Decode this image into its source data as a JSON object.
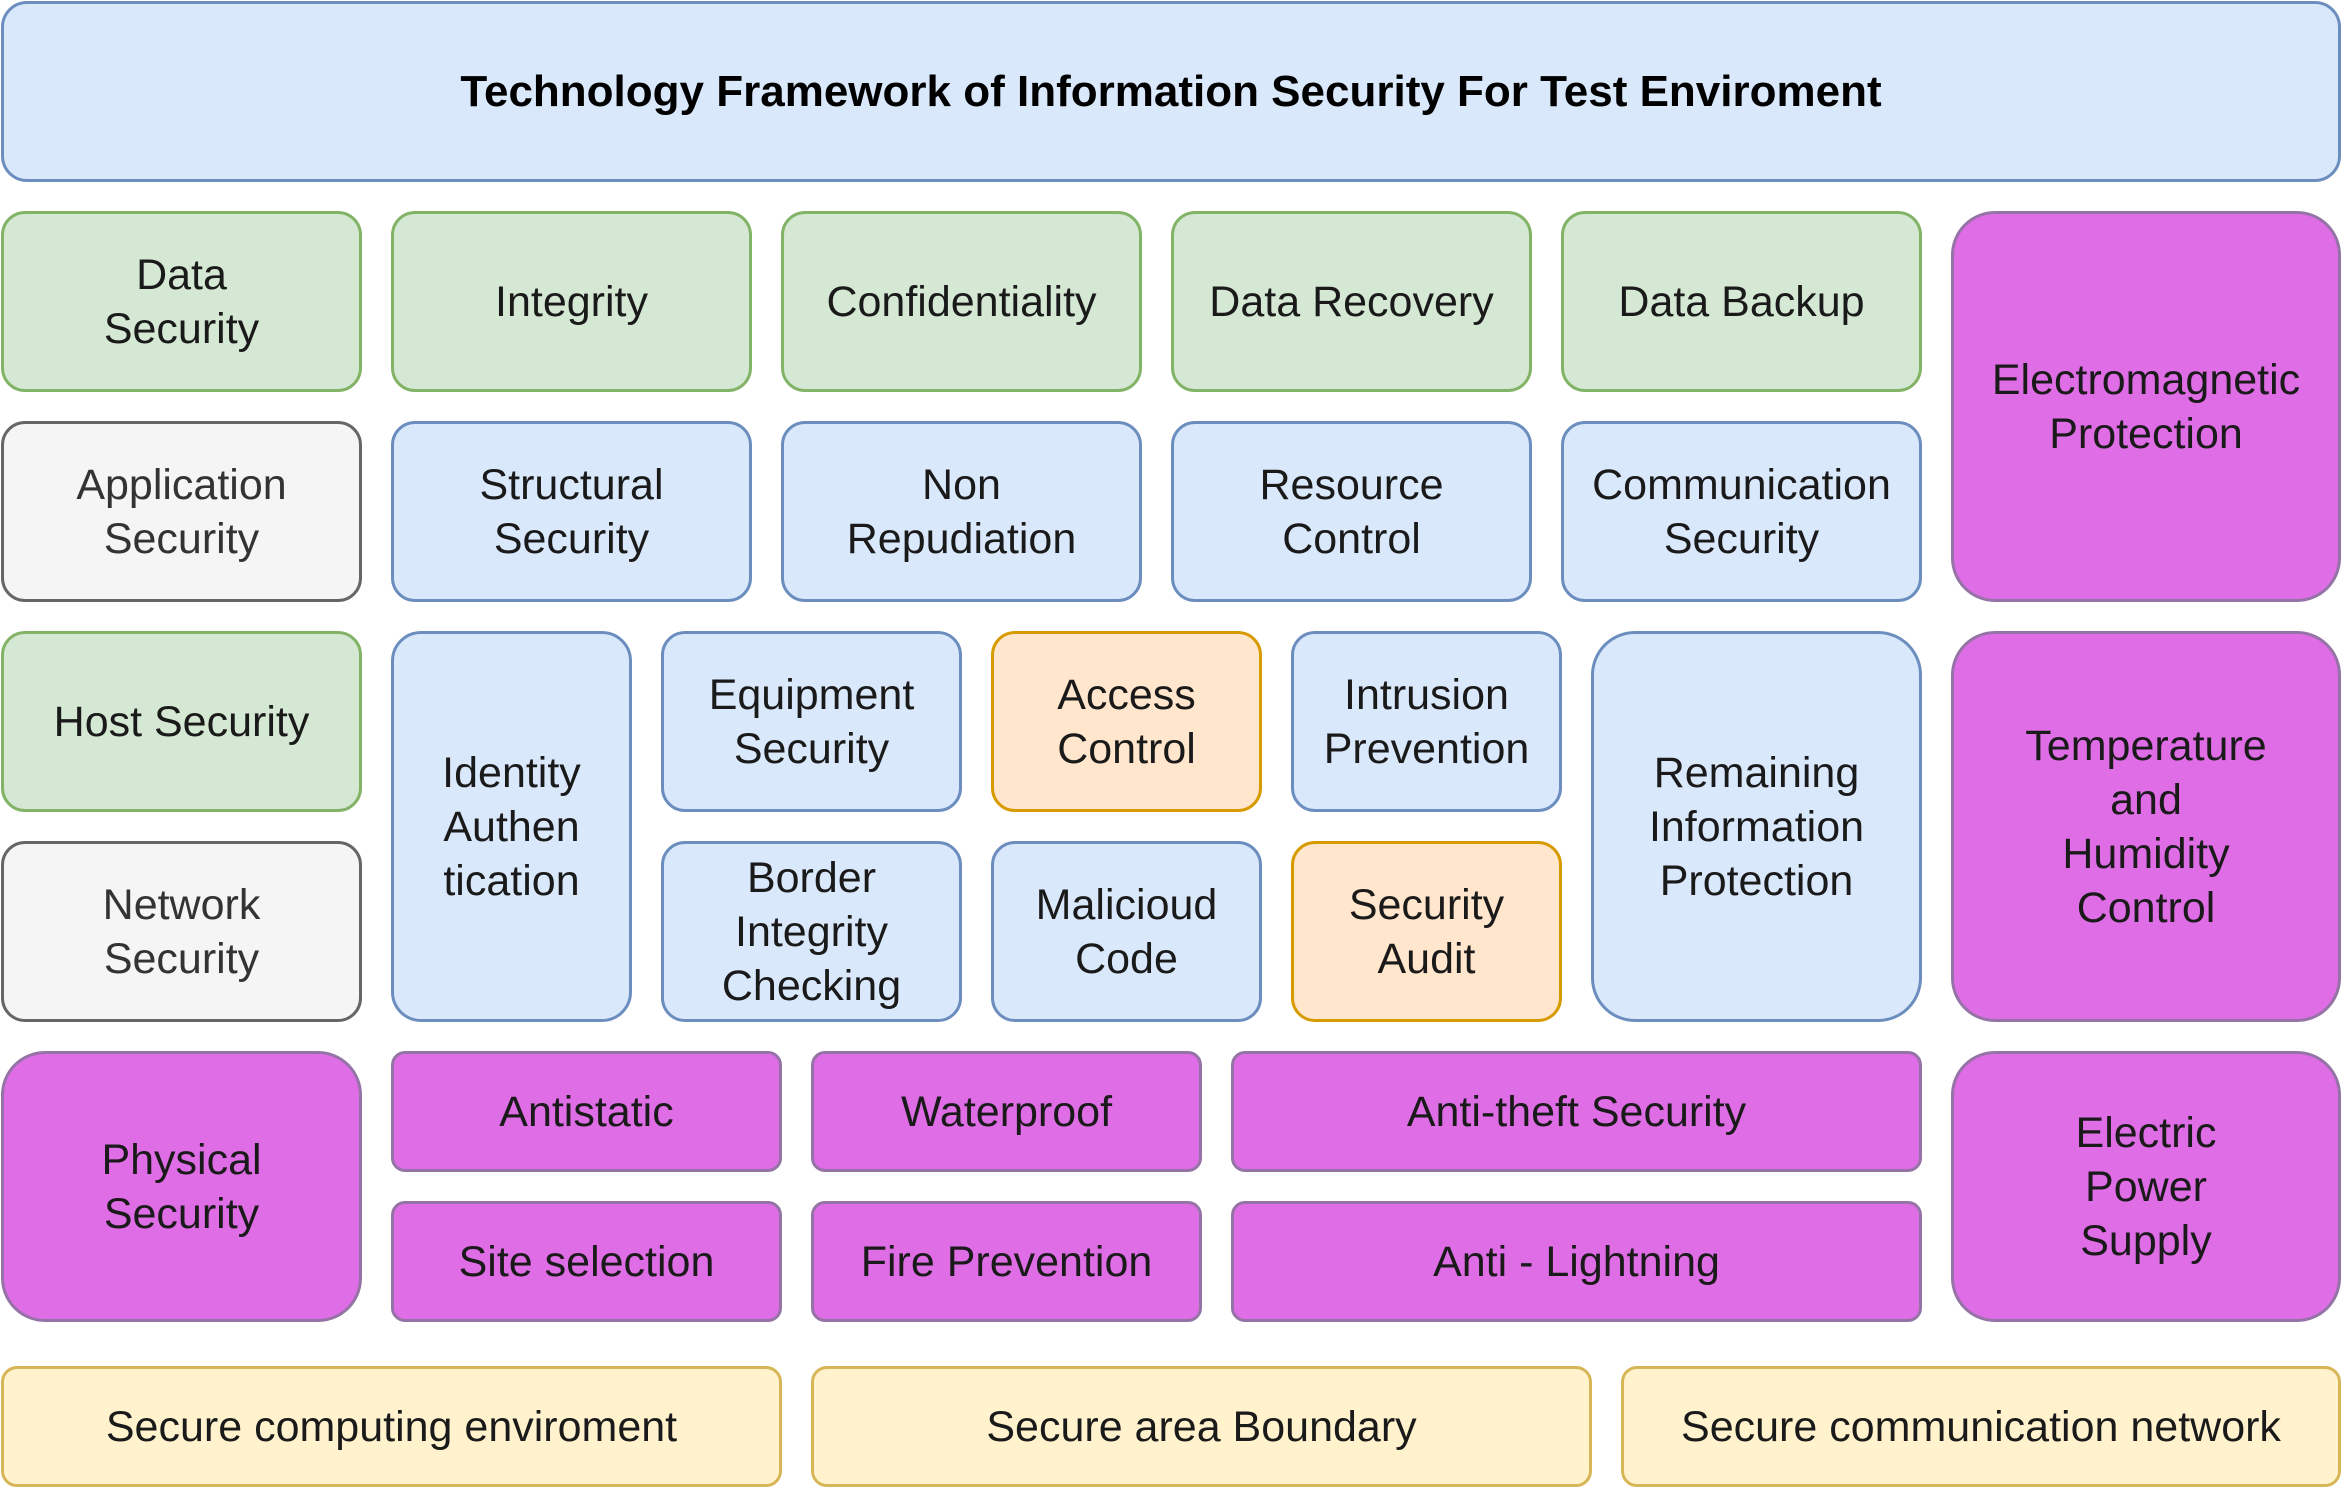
{
  "title": "Technology Framework of Information Security For Test Enviroment",
  "row1": {
    "data_security": "Data\nSecurity",
    "integrity": "Integrity",
    "confidentiality": "Confidentiality",
    "data_recovery": "Data Recovery",
    "data_backup": "Data Backup"
  },
  "electromagnetic": "Electromagnetic\nProtection",
  "row2": {
    "application_security": "Application\nSecurity",
    "structural_security": "Structural\nSecurity",
    "non_repudiation": "Non\nRepudiation",
    "resource_control": "Resource\nControl",
    "communication_security": "Communication\nSecurity"
  },
  "row3": {
    "host_security": "Host Security",
    "network_security": "Network\nSecurity",
    "identity_authentication": "Identity\nAuthen\ntication",
    "equipment_security": "Equipment\nSecurity",
    "access_control": "Access\nControl",
    "intrusion_prevention": "Intrusion\nPrevention",
    "border_integrity": "Border\nIntegrity\nChecking",
    "malicious_code": "Malicioud\nCode",
    "security_audit": "Security\nAudit",
    "remaining_info": "Remaining\nInformation\nProtection",
    "temperature_humidity": "Temperature\nand\nHumidity\nControl"
  },
  "physical": {
    "physical_security": "Physical\nSecurity",
    "antistatic": "Antistatic",
    "waterproof": "Waterproof",
    "anti_theft": "Anti-theft Security",
    "site_selection": "Site selection",
    "fire_prevention": "Fire Prevention",
    "anti_lightning": "Anti - Lightning",
    "electric_power": "Electric\nPower\nSupply"
  },
  "bottom": {
    "secure_computing": "Secure computing enviroment",
    "secure_area": "Secure area Boundary",
    "secure_network": "Secure communication network"
  },
  "colors": {
    "blue_fill": "#dae8fc",
    "blue_stroke": "#6c8ebf",
    "green_fill": "#d5e8d4",
    "green_stroke": "#82b366",
    "grey_fill": "#f5f5f5",
    "grey_stroke": "#666666",
    "orange_fill": "#ffe6cc",
    "orange_stroke": "#d79b00",
    "purple_fill": "#df6de6",
    "purple_stroke": "#9673a6",
    "yellow_fill": "#fff2cc",
    "yellow_stroke": "#d6b656"
  }
}
